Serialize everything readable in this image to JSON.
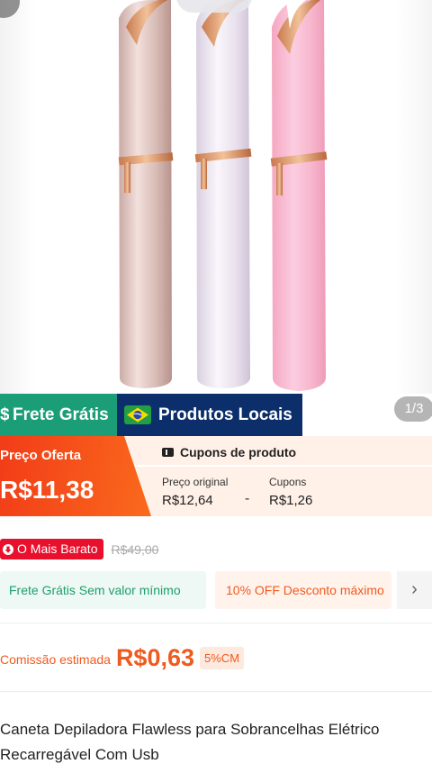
{
  "gallery": {
    "pager": "1/3"
  },
  "features": {
    "frete_symbol": "$",
    "frete": "Frete Grátis",
    "local": "Produtos Locais"
  },
  "price": {
    "offer_label": "Preço Oferta",
    "offer_price": "R$11,38",
    "coupons_title": "Cupons de produto",
    "original_label": "Preço original",
    "original_value": "R$12,64",
    "minus": "-",
    "coupon_label": "Cupons",
    "coupon_value": "R$1,26"
  },
  "cheapest": {
    "badge": "O Mais Barato",
    "old_price": "R$49,00"
  },
  "promos": {
    "free_shipping": "Frete Grátis Sem valor mínimo",
    "discount": "10% OFF Desconto máximo",
    "more_icon": "chevron-right-icon"
  },
  "commission": {
    "label": "Comissão estimada",
    "value": "R$0,63",
    "badge": "5%CM"
  },
  "product": {
    "title": "Caneta Depiladora Flawless para Sobrancelhas Elétrico Recarregável Com Usb"
  },
  "colors": {
    "green": "#1b9e77",
    "navy": "#0c2f6b",
    "orange": "#ef5a1f",
    "red": "#e8102d"
  }
}
